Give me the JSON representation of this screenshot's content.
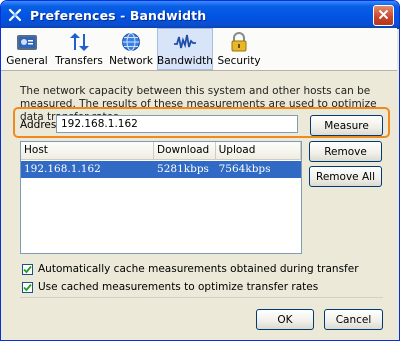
{
  "window": {
    "title": "Preferences - Bandwidth"
  },
  "toolbar": {
    "items": [
      {
        "label": "General",
        "icon": "general-icon"
      },
      {
        "label": "Transfers",
        "icon": "transfers-icon"
      },
      {
        "label": "Network",
        "icon": "network-icon"
      },
      {
        "label": "Bandwidth",
        "icon": "bandwidth-icon",
        "selected": true
      },
      {
        "label": "Security",
        "icon": "lock-icon"
      }
    ]
  },
  "bandwidth": {
    "description": "The network capacity between this system and other hosts can be measured.  The results of these measurements are used to optimize data transfer rates.",
    "address_label": "Address:",
    "address_value": "192.168.1.162",
    "measure_label": "Measure",
    "remove_label": "Remove",
    "remove_all_label": "Remove All",
    "table": {
      "headers": [
        "Host",
        "Download",
        "Upload"
      ],
      "rows": [
        {
          "host": "192.168.1.162",
          "download": "5281kbps",
          "upload": "7564kbps",
          "selected": true
        }
      ]
    },
    "auto_cache_label": "Automatically cache measurements obtained during transfer",
    "auto_cache_checked": true,
    "use_cached_label": "Use cached measurements to optimize transfer rates",
    "use_cached_checked": true
  },
  "footer": {
    "ok_label": "OK",
    "cancel_label": "Cancel"
  },
  "colors": {
    "highlight": "#f08a1f",
    "selection": "#316ac5",
    "titlebar": "#0054e3"
  }
}
